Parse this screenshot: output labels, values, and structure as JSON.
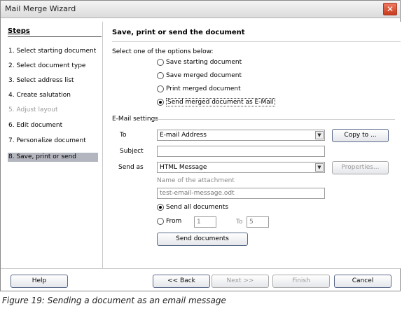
{
  "window": {
    "title": "Mail Merge Wizard",
    "close_label": "✕"
  },
  "sidebar": {
    "title": "Steps",
    "items": [
      {
        "label": "1.  Select starting document",
        "state": "normal"
      },
      {
        "label": "2.  Select document type",
        "state": "normal"
      },
      {
        "label": "3.  Select address list",
        "state": "normal"
      },
      {
        "label": "4.  Create salutation",
        "state": "normal"
      },
      {
        "label": "5.  Adjust layout",
        "state": "disabled"
      },
      {
        "label": "6.  Edit document",
        "state": "normal"
      },
      {
        "label": "7.  Personalize document",
        "state": "normal"
      },
      {
        "label": "8.  Save, print or send",
        "state": "active"
      }
    ]
  },
  "main": {
    "title": "Save, print or send the document",
    "prompt": "Select one of the options below:",
    "options": [
      {
        "label": "Save starting document",
        "selected": false
      },
      {
        "label": "Save merged document",
        "selected": false
      },
      {
        "label": "Print merged document",
        "selected": false
      },
      {
        "label": "Send merged document as E-Mail",
        "selected": true
      }
    ]
  },
  "email": {
    "group_label": "E-Mail settings",
    "to_label": "To",
    "to_value": "E-mail Address",
    "copy_to_label": "Copy to ...",
    "subject_label": "Subject",
    "subject_value": "",
    "send_as_label": "Send as",
    "send_as_value": "HTML Message",
    "properties_label": "Properties...",
    "attachment_label": "Name of the attachment",
    "attachment_value": "test-email-message.odt",
    "send_all_label": "Send all documents",
    "from_label": "From",
    "from_value": "1",
    "to_range_label": "To",
    "to_range_value": "5",
    "send_button_label": "Send documents"
  },
  "footer": {
    "help_label": "Help",
    "back_label": "<< Back",
    "next_label": "Next >>",
    "finish_label": "Finish",
    "cancel_label": "Cancel"
  },
  "caption": "Figure 19: Sending a document as an email message"
}
